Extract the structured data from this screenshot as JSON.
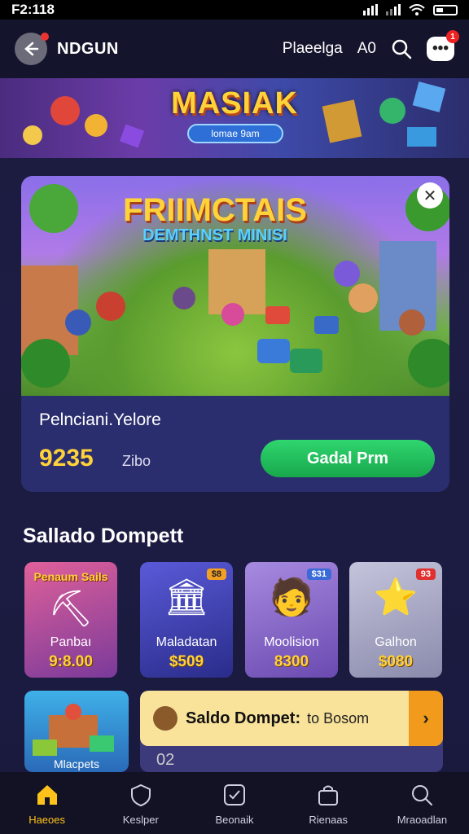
{
  "status_bar": {
    "time": "F2:118"
  },
  "header": {
    "title": "NDGUN",
    "link_label": "Plaeelga",
    "counter": "A0",
    "chat_badge": "1"
  },
  "banner": {
    "title": "MASIAK",
    "subtitle": "lomae 9am"
  },
  "featured": {
    "art_title_line1": "FRIIMCTAIS",
    "art_title_line2": "DEMTHNST MINISI",
    "game_name": "Pelnciani.Yelore",
    "price": "9235",
    "price_sub": "Zibo",
    "cta_label": "Gadal Prm"
  },
  "section": {
    "title": "Sallado Dompett"
  },
  "tiles": [
    {
      "header": "Penaum Sails",
      "name": "Panbaı",
      "price": "9:8.00",
      "tag": "",
      "bg": "#c24a8a",
      "icon": "⛏"
    },
    {
      "header": "",
      "name": "Maladatan",
      "price": "$509",
      "tag": "$8",
      "bg": "#4046b8",
      "icon": "🏛"
    },
    {
      "header": "",
      "name": "Moolision",
      "price": "8300",
      "tag": "$31",
      "bg": "#8a6ac8",
      "icon": "🧑"
    },
    {
      "header": "",
      "name": "Galhon",
      "price": "$080",
      "tag": "93",
      "bg": "#a9a9c8",
      "icon": "⭐"
    }
  ],
  "tile5": {
    "label": "Mlacpets"
  },
  "wallet": {
    "label": "Saldo Dompet:",
    "sub": "to Bosom",
    "extra": "02"
  },
  "nav": [
    {
      "label": "Haeoes",
      "icon": "home-icon"
    },
    {
      "label": "Keslper",
      "icon": "shield-icon"
    },
    {
      "label": "Beonaik",
      "icon": "square-check-icon"
    },
    {
      "label": "Rienaas",
      "icon": "bag-icon"
    },
    {
      "label": "Mraoadlan",
      "icon": "search-icon"
    }
  ],
  "colors": {
    "accent": "#ffc21a",
    "cta": "#22c05c",
    "price": "#ffd23a"
  }
}
